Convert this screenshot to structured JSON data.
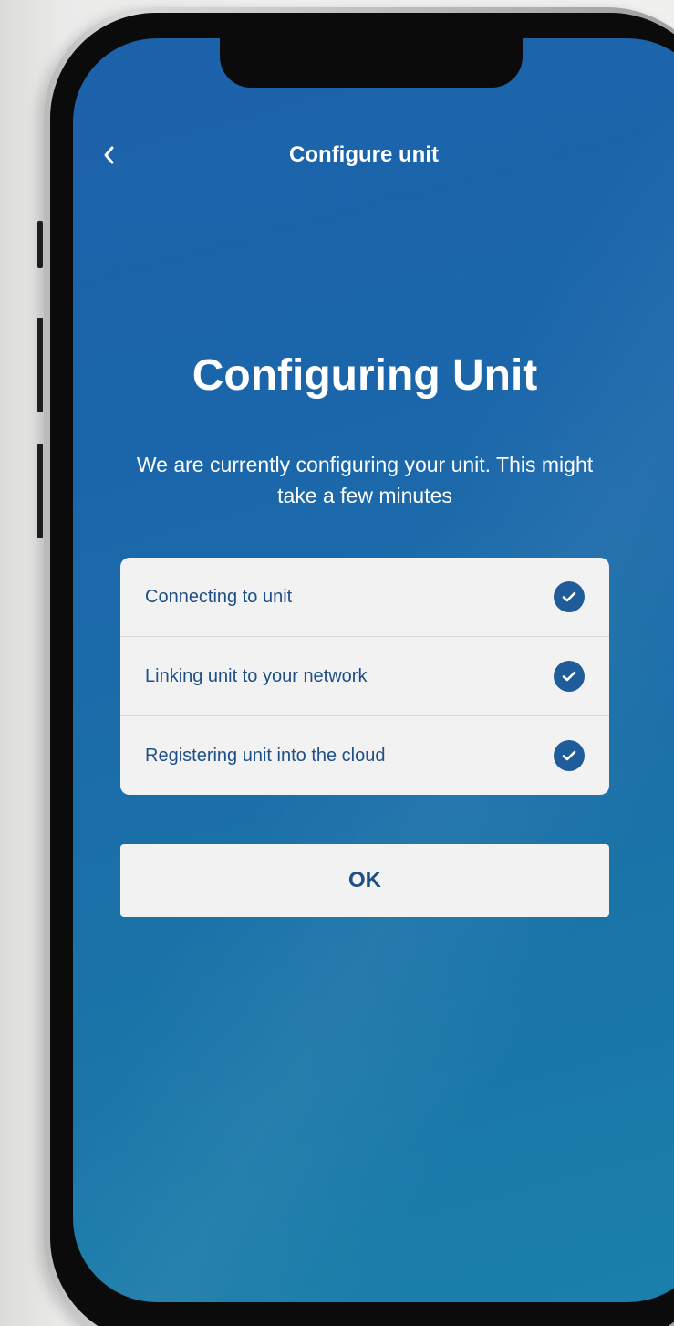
{
  "header": {
    "title": "Configure unit",
    "back_icon": "chevron-left-icon"
  },
  "main": {
    "heading": "Configuring Unit",
    "subtitle": "We are currently configuring your unit. This might take a few minutes",
    "steps": [
      {
        "label": "Connecting to unit",
        "status": "complete",
        "icon": "check-circle-icon"
      },
      {
        "label": "Linking unit to your network",
        "status": "complete",
        "icon": "check-circle-icon"
      },
      {
        "label": "Registering unit into the cloud",
        "status": "complete",
        "icon": "check-circle-icon"
      }
    ],
    "ok_label": "OK"
  },
  "colors": {
    "screen_gradient_top": "#1c62ab",
    "screen_gradient_bottom": "#1a80aa",
    "card_background": "#f2f2f3",
    "label_text": "#1e4f86",
    "check_fill": "#1e5d9a"
  }
}
